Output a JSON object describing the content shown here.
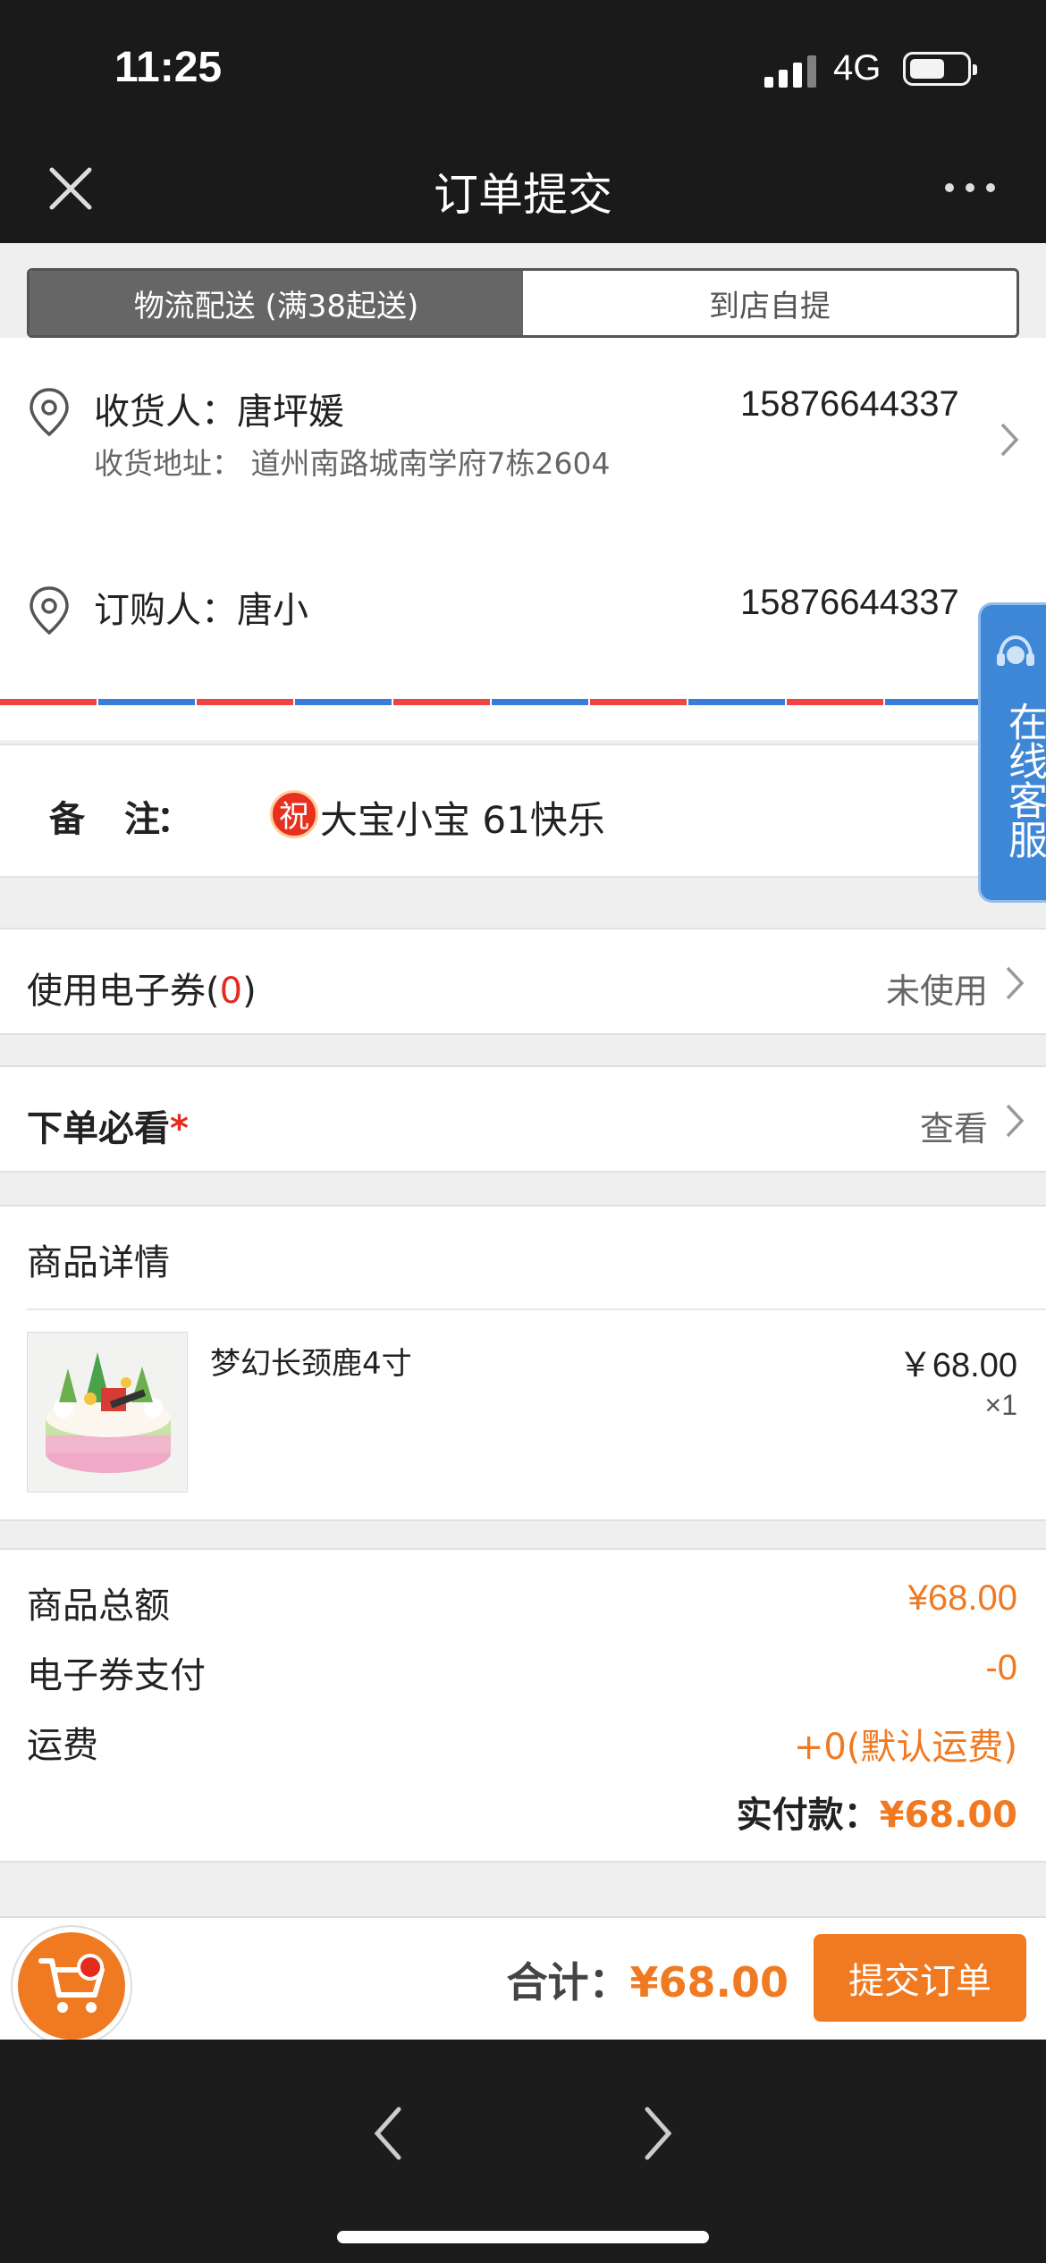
{
  "status_bar": {
    "time": "11:25",
    "network": "4G",
    "battery_level": 0.6
  },
  "nav": {
    "title": "订单提交",
    "close_icon": "close-icon",
    "more_icon": "more-icon"
  },
  "delivery_tabs": [
    {
      "label": "物流配送 (满38起送)",
      "active": true
    },
    {
      "label": "到店自提",
      "active": false
    }
  ],
  "receiver": {
    "line1": "收货人：唐坪媛",
    "phone": "15876644337",
    "address": "收货地址： 道州南路城南学府7栋2604"
  },
  "buyer": {
    "line1": "订购人：唐小",
    "phone": "15876644337"
  },
  "remark": {
    "label": "备注",
    "colon": "：",
    "blessing_badge": "祝",
    "text": "大宝小宝 61快乐"
  },
  "coupon": {
    "label_prefix": "使用电子券(",
    "count": "0",
    "label_suffix": ")",
    "value": "未使用"
  },
  "notice": {
    "label": "下单必看",
    "required_mark": "*",
    "value": "查看"
  },
  "detail": {
    "title": "商品详情",
    "items": [
      {
        "name": "梦幻长颈鹿4寸",
        "price": "￥68.00",
        "qty": "×1",
        "image_caption": "梦幻长颈鹿"
      }
    ]
  },
  "summary": {
    "rows": [
      {
        "label": "商品总额",
        "value": "¥68.00"
      },
      {
        "label": "电子券支付",
        "value": "-0"
      },
      {
        "label": "运费",
        "value": "+0(默认运费)"
      }
    ],
    "paid_label": "实付款：",
    "paid_value": "¥68.00"
  },
  "bottom_bar": {
    "total_label": "合计：",
    "total_value": "¥68.00",
    "submit_label": "提交订单"
  },
  "service_tab": {
    "label": "在线客服"
  },
  "colors": {
    "accent": "#f07a22",
    "red": "#e52a1e",
    "service_blue": "#3e86d6"
  }
}
